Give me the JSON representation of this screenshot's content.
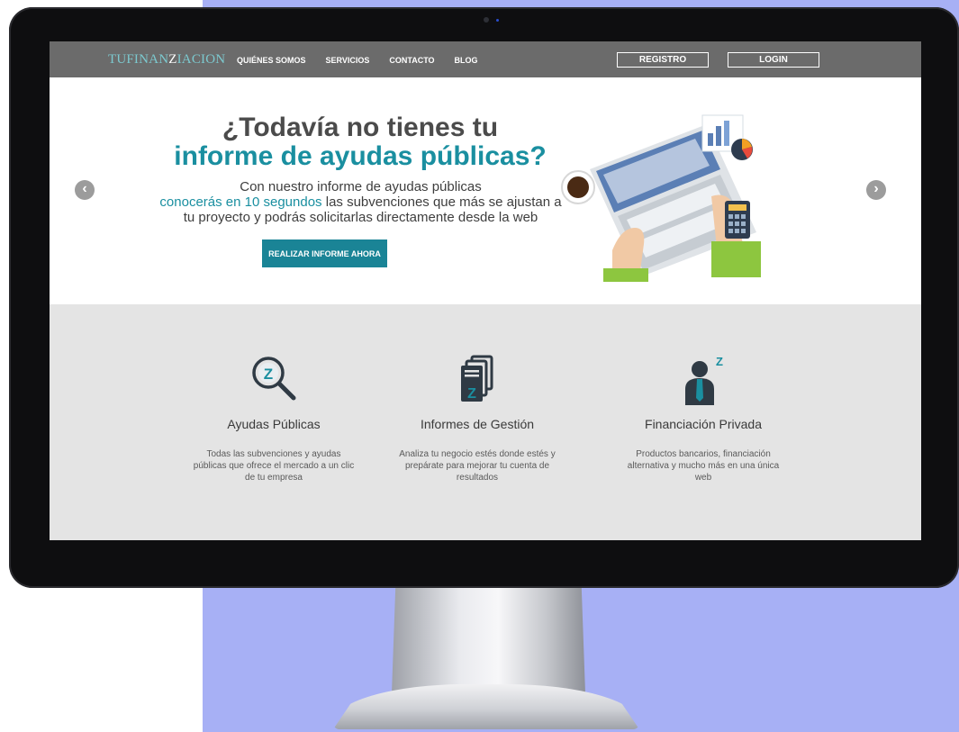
{
  "nav": {
    "brand_prefix": "TUFINAN",
    "brand_z": "Z",
    "brand_suffix": "IACION",
    "links": [
      "QUIÉNES SOMOS",
      "SERVICIOS",
      "CONTACTO",
      "BLOG"
    ],
    "register_label": "REGISTRO",
    "login_label": "LOGIN"
  },
  "hero": {
    "title_line1": "¿Todavía no tienes tu",
    "title_line2": "informe de ayudas públicas?",
    "desc_line1": "Con nuestro informe de ayudas públicas",
    "desc_highlight": "conocerás en 10 segundos",
    "desc_rest": " las subvenciones que más se ajustan a",
    "desc_line3": "tu proyecto y podrás solicitarlas directamente desde la web",
    "cta_label": "REALIZAR INFORME AHORA",
    "prev_arrow": "‹",
    "next_arrow": "›"
  },
  "features": [
    {
      "icon": "magnifier-z-icon",
      "title": "Ayudas Públicas",
      "desc": "Todas las subvenciones y ayudas públicas que ofrece el mercado a un clic de tu empresa"
    },
    {
      "icon": "documents-z-icon",
      "title": "Informes de Gestión",
      "desc": "Analiza tu negocio estés donde estés y prepárate para mejorar tu cuenta de resultados"
    },
    {
      "icon": "businessman-z-icon",
      "title": "Financiación Privada",
      "desc": "Productos bancarios, financiación alternativa y mucho más en una única web"
    }
  ],
  "colors": {
    "accent": "#1a8fa0",
    "nav_bg": "#6b6b6b",
    "feature_bg": "#e4e4e4",
    "backdrop": "#a7b0f5"
  },
  "apple_logo": ""
}
